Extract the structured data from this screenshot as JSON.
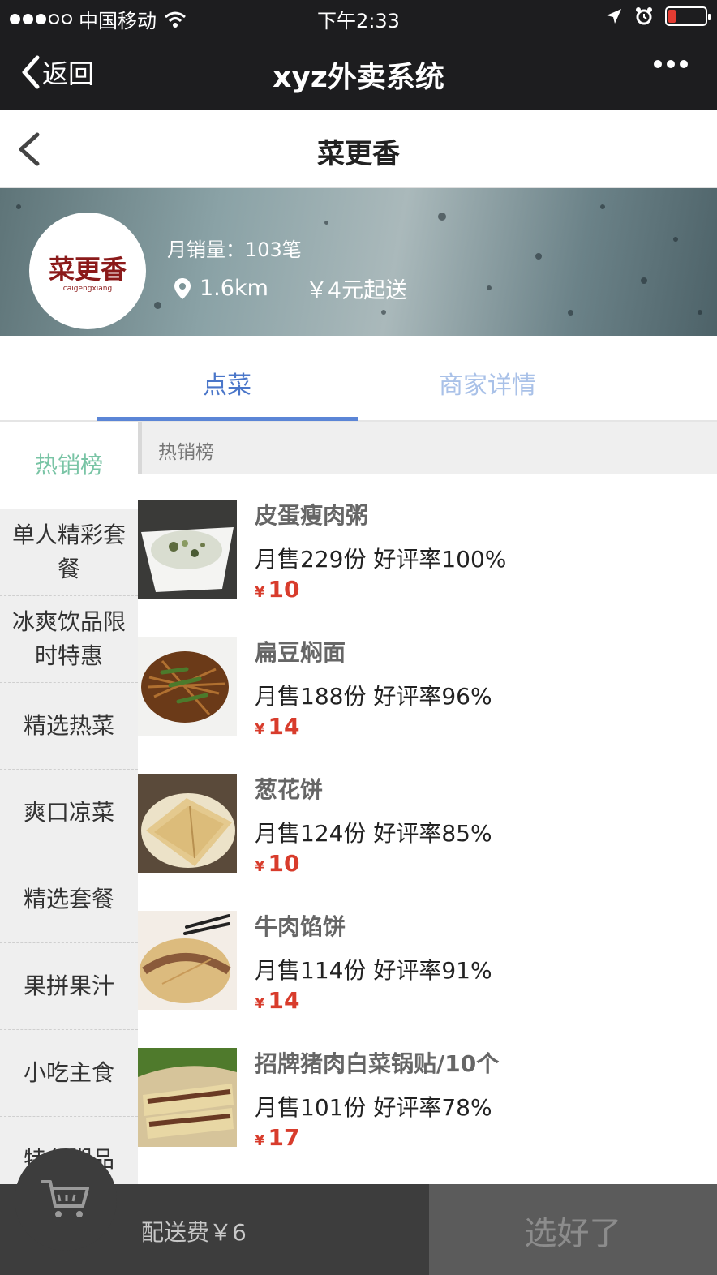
{
  "status_bar": {
    "carrier": "中国移动",
    "time": "下午2:33"
  },
  "nav": {
    "back_label": "返回",
    "title": "xyz外卖系统"
  },
  "page": {
    "title": "菜更香"
  },
  "shop": {
    "logo_text": "菜更香",
    "logo_subtext": "caigengxiang",
    "monthly_sales": "月销量：103笔",
    "distance": "1.6km",
    "min_order": "￥4元起送"
  },
  "tabs": [
    {
      "label": "点菜",
      "active": true
    },
    {
      "label": "商家详情",
      "active": false
    }
  ],
  "categories": [
    "热销榜",
    "单人精彩套餐",
    "冰爽饮品限时特惠",
    "精选热菜",
    "爽口凉菜",
    "精选套餐",
    "果拼果汁",
    "小吃主食",
    "特色粥品"
  ],
  "section_title": "热销榜",
  "items": [
    {
      "name": "皮蛋瘦肉粥",
      "stats": "月售229份 好评率100%",
      "currency": "¥",
      "price": "10"
    },
    {
      "name": "扁豆焖面",
      "stats": "月售188份 好评率96%",
      "currency": "¥",
      "price": "14"
    },
    {
      "name": "葱花饼",
      "stats": "月售124份 好评率85%",
      "currency": "¥",
      "price": "10"
    },
    {
      "name": "牛肉馅饼",
      "stats": "月售114份 好评率91%",
      "currency": "¥",
      "price": "14"
    },
    {
      "name": "招牌猪肉白菜锅贴/10个",
      "stats": "月售101份 好评率78%",
      "currency": "¥",
      "price": "17"
    }
  ],
  "cart": {
    "delivery_fee": "配送费￥6",
    "confirm_label": "选好了"
  },
  "colors": {
    "accent_blue": "#4a76c9",
    "category_active": "#79c4a5",
    "price_red": "#d83c2c",
    "bar_dark": "#1d1d1f"
  }
}
